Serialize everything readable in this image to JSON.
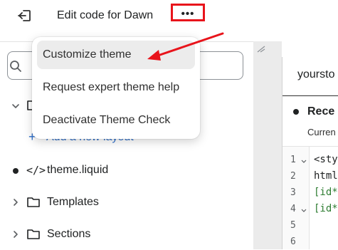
{
  "header": {
    "title": "Edit code for Dawn",
    "more_label": "•••"
  },
  "menu": {
    "items": [
      {
        "label": "Customize theme"
      },
      {
        "label": "Request expert theme help"
      },
      {
        "label": "Deactivate Theme Check"
      }
    ]
  },
  "sidebar": {
    "add_layout_label": "Add a new layout",
    "files": [
      {
        "label": "theme.liquid"
      }
    ],
    "folders": [
      {
        "label": "Templates"
      },
      {
        "label": "Sections"
      }
    ]
  },
  "editor": {
    "tab_label": "yoursto",
    "recent_heading": "Rece",
    "current_label": "Curren",
    "line_numbers": [
      "1",
      "2",
      "3",
      "4",
      "5",
      "6"
    ],
    "code_lines": [
      "<sty",
      "html",
      "[id*",
      "[id*"
    ]
  },
  "colors": {
    "annotation_red": "#e8141b",
    "accent_blue": "#2c6ecb",
    "code_green": "#2e7d32"
  }
}
